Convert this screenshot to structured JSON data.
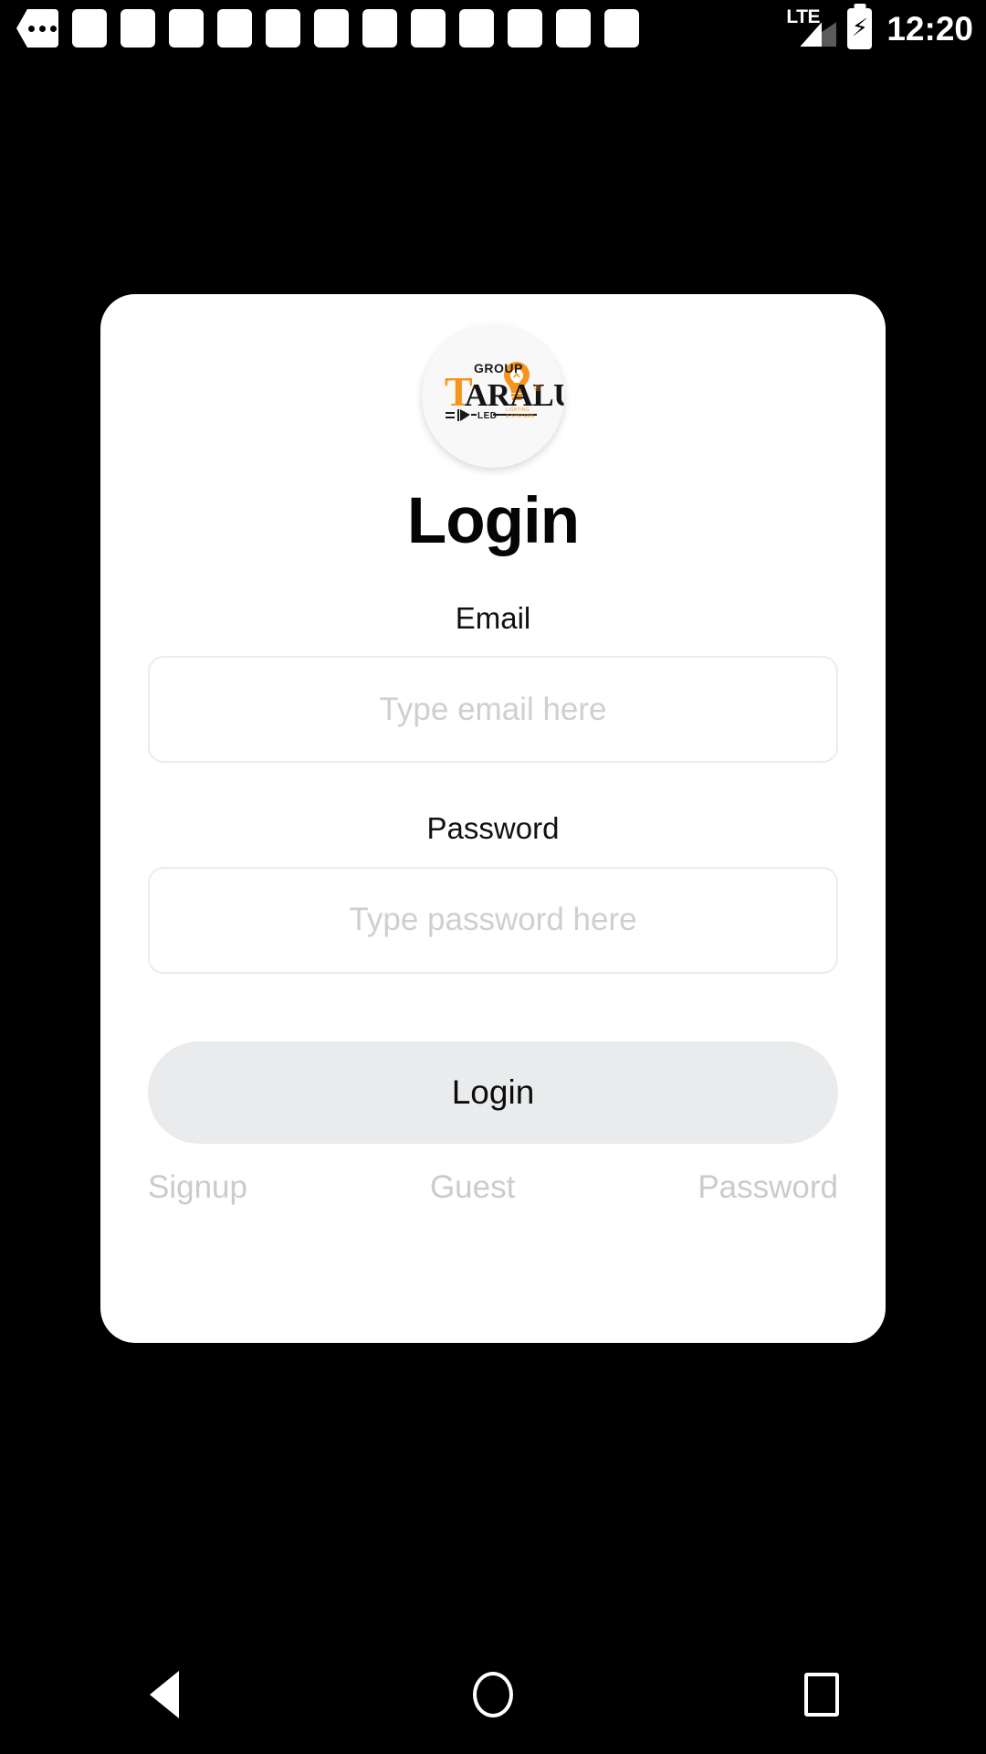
{
  "status_bar": {
    "more_notifications_icon": "more-notifications-icon",
    "notification_placeholder_count": 12,
    "network_type": "LTE",
    "signal_icon": "cellular-signal-icon",
    "battery_icon": "battery-charging-icon",
    "battery_bolt_glyph": "⚡",
    "clock": "12:20"
  },
  "card": {
    "logo": {
      "icon_name": "taralux-group-logo",
      "group_text": "GROUP",
      "brand_text_lead": "T",
      "brand_text_rest": "ARALUX",
      "led_text": "LED",
      "trademark": "®",
      "tagline": "LIGHTING & SYSTEMS",
      "accent_color": "#F7941E"
    },
    "title": "Login",
    "email": {
      "label": "Email",
      "placeholder": "Type email here",
      "value": ""
    },
    "password": {
      "label": "Password",
      "placeholder": "Type password here",
      "value": ""
    },
    "submit_label": "Login",
    "links": {
      "signup": "Signup",
      "guest": "Guest",
      "password": "Password"
    },
    "colors": {
      "card_bg": "#FFFFFF",
      "submit_bg": "#E9EBEC",
      "input_border": "#ECECEC",
      "placeholder": "#CFCFCF",
      "link": "#CBCBCB",
      "title": "#050505",
      "screen_bg": "#000000"
    }
  },
  "nav_bar": {
    "back_label": "Back",
    "home_label": "Home",
    "recents_label": "Recents",
    "back_icon": "triangle-back-icon",
    "home_icon": "circle-home-icon",
    "recents_icon": "square-recents-icon"
  }
}
